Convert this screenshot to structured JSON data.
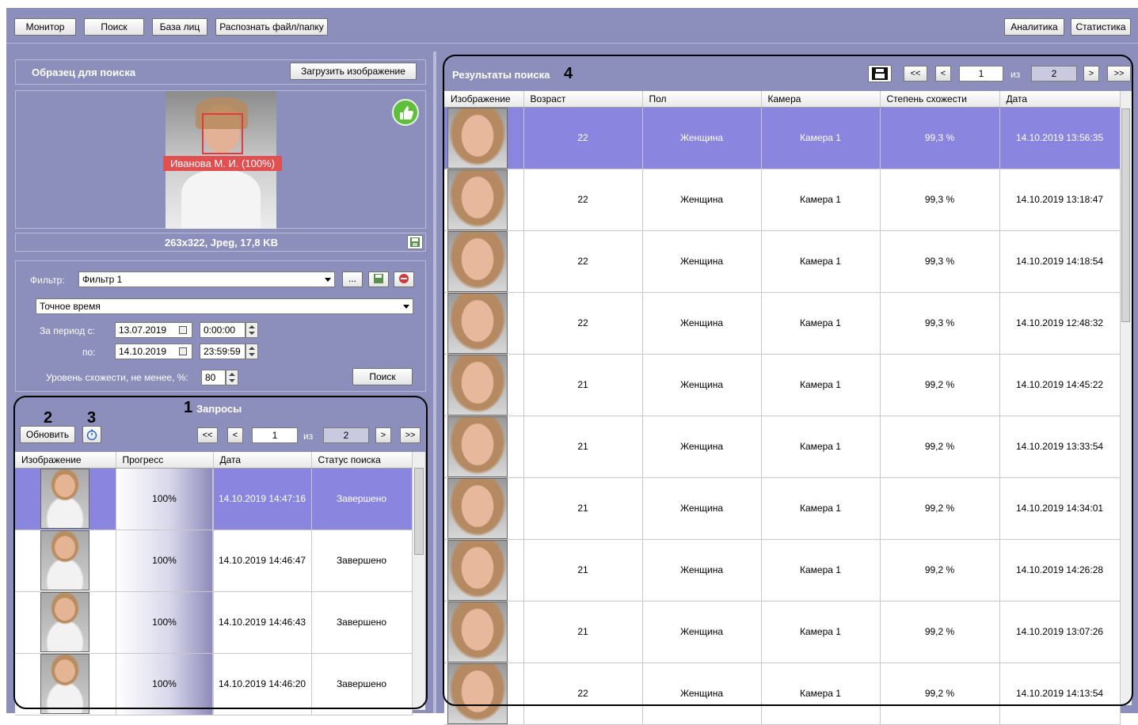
{
  "toolbar": {
    "monitor": "Монитор",
    "search": "Поиск",
    "face_db": "База лиц",
    "recognize": "Распознать файл/папку",
    "analytics": "Аналитика",
    "statistics": "Статистика"
  },
  "sample": {
    "title": "Образец для поиска",
    "upload_button": "Загрузить изображение",
    "face_label": "Иванова М. И. (100%)",
    "image_info": "263x322, Jpeg, 17,8 KB"
  },
  "filter": {
    "label": "Фильтр:",
    "value": "Фильтр 1",
    "more_button": "...",
    "time_mode": "Точное время",
    "period_from_label": "За период с:",
    "from_date": "13.07.2019",
    "from_time": "0:00:00",
    "to_label": "по:",
    "to_date": "14.10.2019",
    "to_time": "23:59:59",
    "similarity_label": "Уровень схожести, не менее, %:",
    "similarity_value": "80",
    "search_button": "Поиск"
  },
  "requests": {
    "title": "Запросы",
    "refresh_button": "Обновить",
    "page": "1",
    "of_label": "из",
    "total_pages": "2",
    "nav": {
      "first": "<<",
      "prev": "<",
      "next": ">",
      "last": ">>"
    },
    "columns": [
      "Изображение",
      "Прогресс",
      "Дата",
      "Статус поиска"
    ],
    "rows": [
      {
        "progress": "100%",
        "date": "14.10.2019 14:47:16",
        "status": "Завершено",
        "selected": true
      },
      {
        "progress": "100%",
        "date": "14.10.2019 14:46:47",
        "status": "Завершено",
        "selected": false
      },
      {
        "progress": "100%",
        "date": "14.10.2019 14:46:43",
        "status": "Завершено",
        "selected": false
      },
      {
        "progress": "100%",
        "date": "14.10.2019 14:46:20",
        "status": "Завершено",
        "selected": false
      }
    ]
  },
  "results": {
    "title": "Результаты поиска",
    "page": "1",
    "of_label": "из",
    "total_pages": "2",
    "nav": {
      "first": "<<",
      "prev": "<",
      "next": ">",
      "last": ">>"
    },
    "columns": [
      "Изображение",
      "Возраст",
      "Пол",
      "Камера",
      "Степень схожести",
      "Дата"
    ],
    "rows": [
      {
        "age": "22",
        "gender": "Женщина",
        "camera": "Камера 1",
        "similarity": "99,3 %",
        "date": "14.10.2019 13:56:35",
        "selected": true
      },
      {
        "age": "22",
        "gender": "Женщина",
        "camera": "Камера 1",
        "similarity": "99,3 %",
        "date": "14.10.2019 13:18:47",
        "selected": false
      },
      {
        "age": "22",
        "gender": "Женщина",
        "camera": "Камера 1",
        "similarity": "99,3 %",
        "date": "14.10.2019 14:18:54",
        "selected": false
      },
      {
        "age": "22",
        "gender": "Женщина",
        "camera": "Камера 1",
        "similarity": "99,3 %",
        "date": "14.10.2019 12:48:32",
        "selected": false
      },
      {
        "age": "21",
        "gender": "Женщина",
        "camera": "Камера 1",
        "similarity": "99,2 %",
        "date": "14.10.2019 14:45:22",
        "selected": false
      },
      {
        "age": "21",
        "gender": "Женщина",
        "camera": "Камера 1",
        "similarity": "99,2 %",
        "date": "14.10.2019 13:33:54",
        "selected": false
      },
      {
        "age": "21",
        "gender": "Женщина",
        "camera": "Камера 1",
        "similarity": "99,2 %",
        "date": "14.10.2019 14:34:01",
        "selected": false
      },
      {
        "age": "21",
        "gender": "Женщина",
        "camera": "Камера 1",
        "similarity": "99,2 %",
        "date": "14.10.2019 14:26:28",
        "selected": false
      },
      {
        "age": "21",
        "gender": "Женщина",
        "camera": "Камера 1",
        "similarity": "99,2 %",
        "date": "14.10.2019 13:07:26",
        "selected": false
      },
      {
        "age": "22",
        "gender": "Женщина",
        "camera": "Камера 1",
        "similarity": "99,2 %",
        "date": "14.10.2019 14:13:54",
        "selected": false
      }
    ]
  },
  "callouts": {
    "c1": "1",
    "c2": "2",
    "c3": "3",
    "c4": "4"
  }
}
